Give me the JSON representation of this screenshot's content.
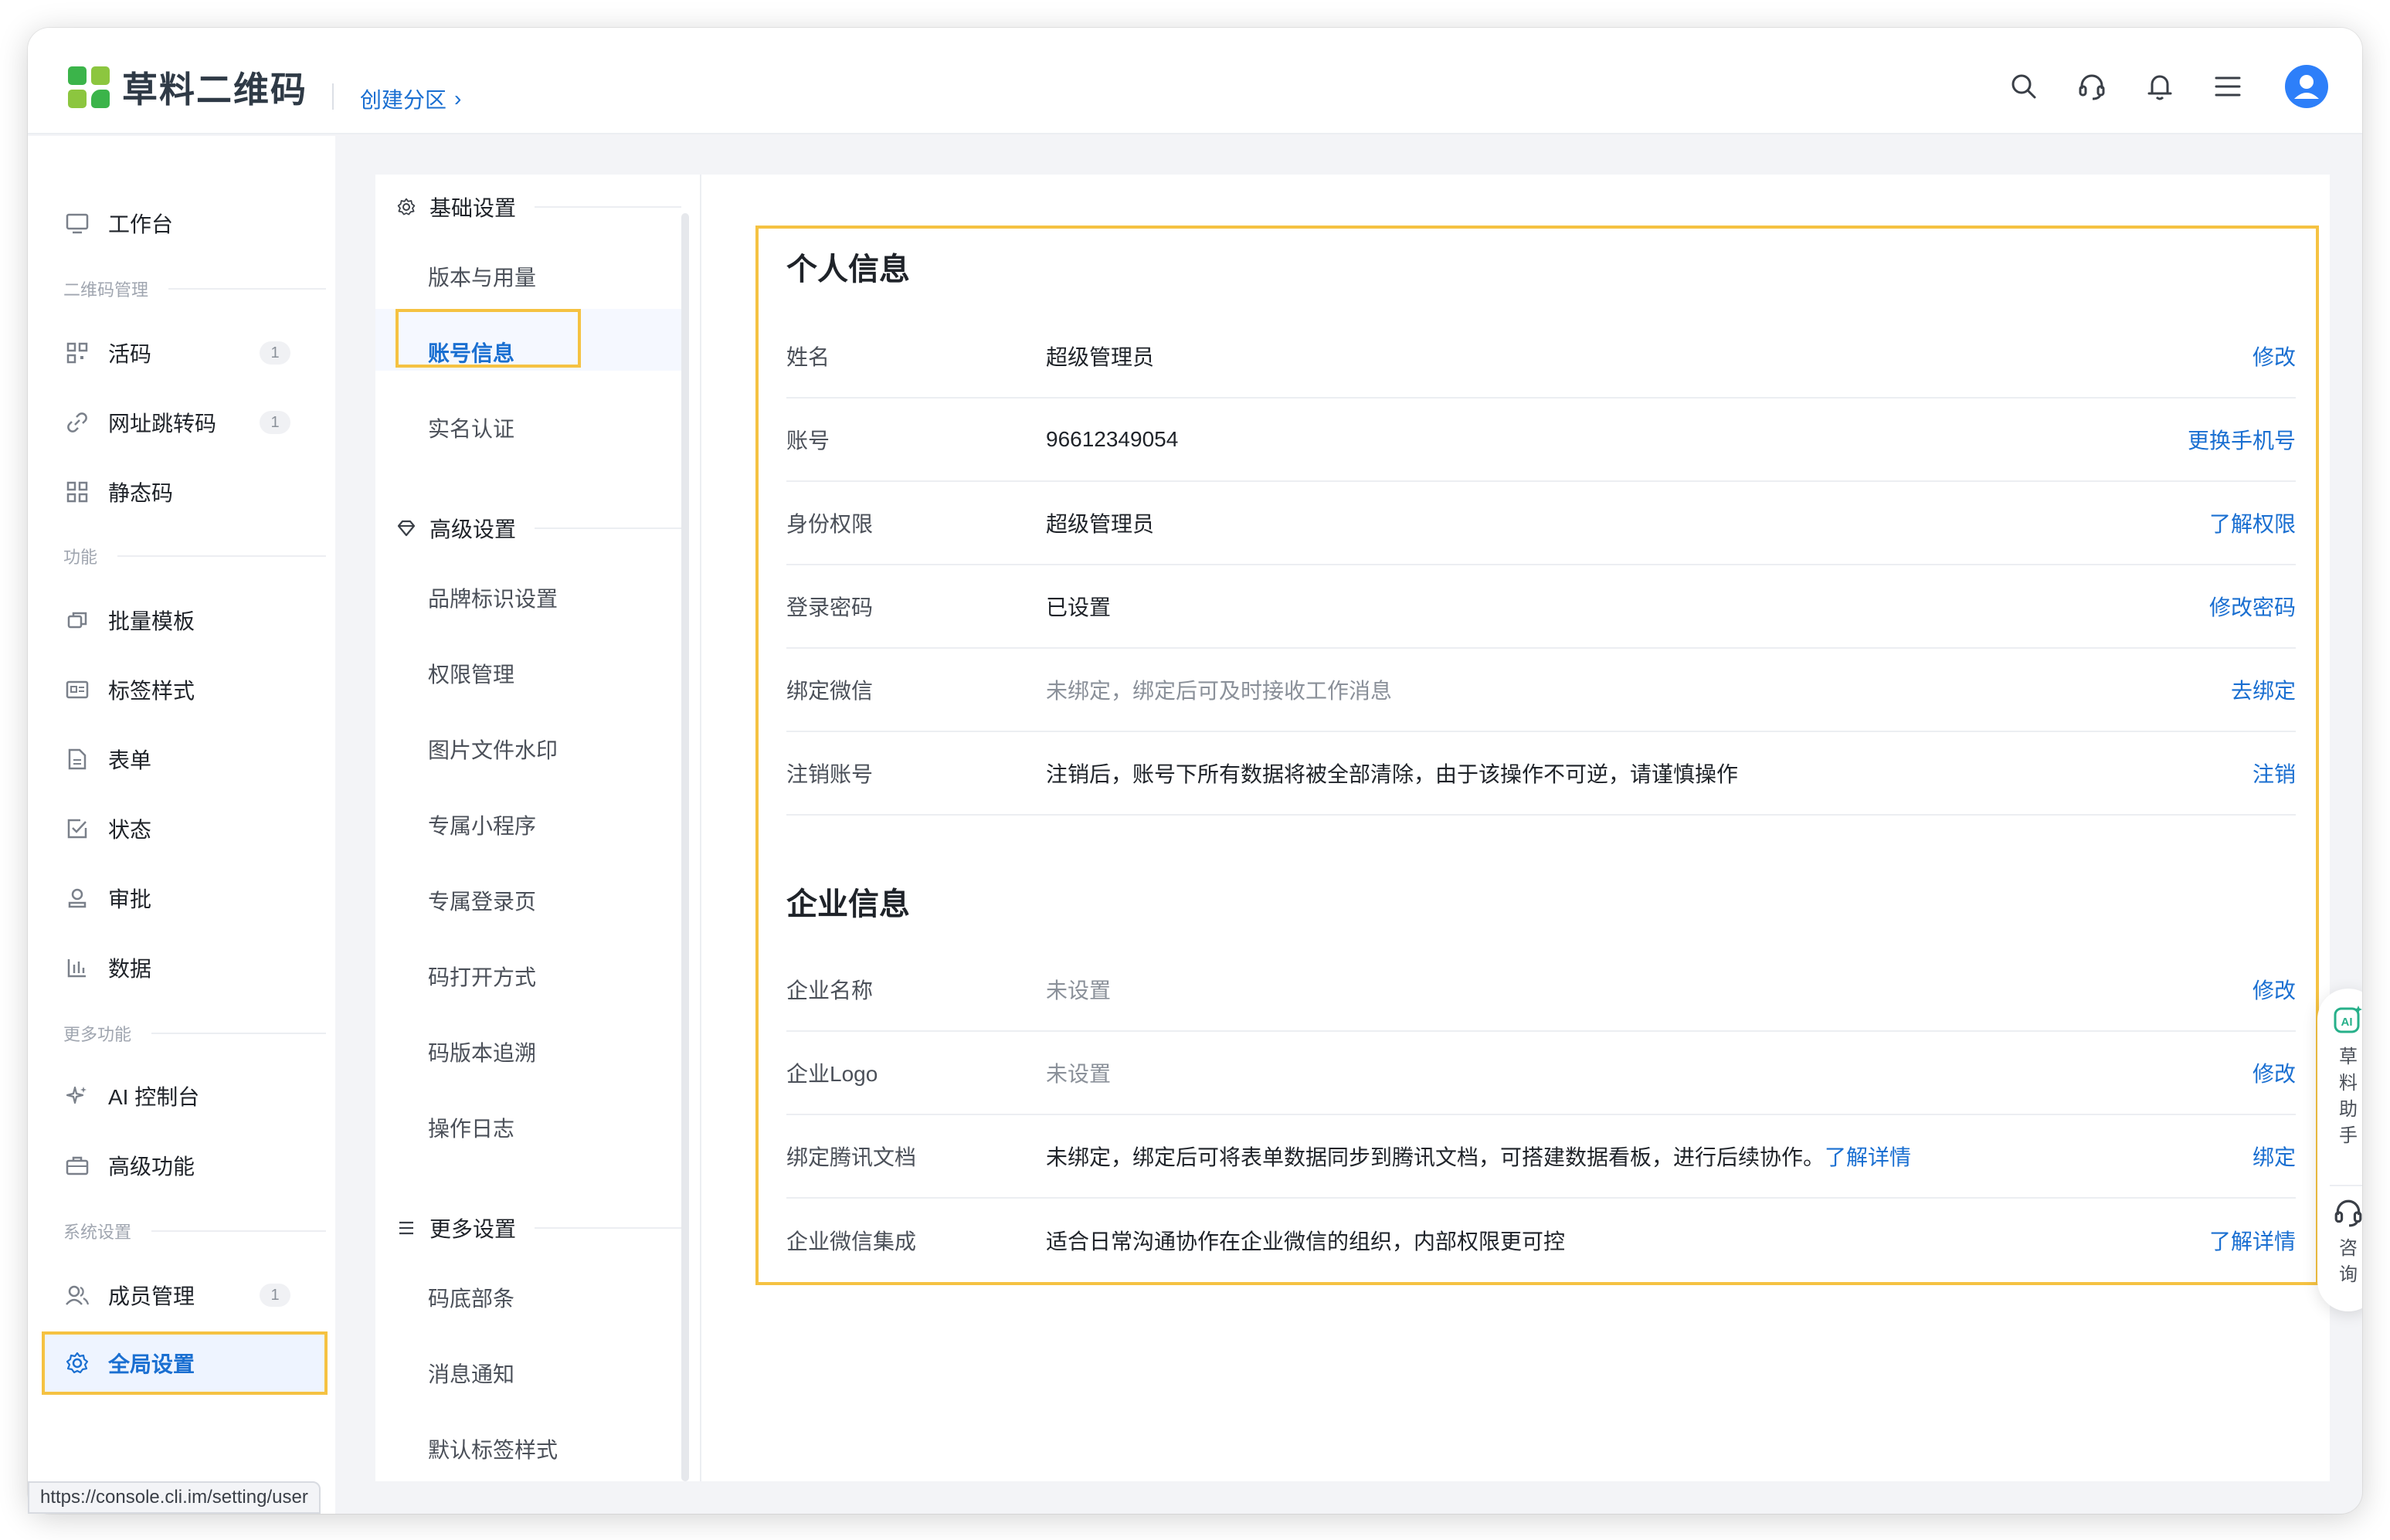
{
  "header": {
    "logo_text": "草料二维码",
    "breadcrumb": "创建分区",
    "icons": [
      "search-icon",
      "headset-icon",
      "bell-icon",
      "menu-icon",
      "avatar"
    ]
  },
  "sidebar": {
    "workbench": "工作台",
    "group_qr": "二维码管理",
    "live_code": "活码",
    "live_code_count": "1",
    "url_code": "网址跳转码",
    "url_code_count": "1",
    "static_code": "静态码",
    "group_func": "功能",
    "batch_template": "批量模板",
    "label_style": "标签样式",
    "form": "表单",
    "status": "状态",
    "approval": "审批",
    "data": "数据",
    "group_more": "更多功能",
    "ai_console": "AI 控制台",
    "advanced_func": "高级功能",
    "group_system": "系统设置",
    "members": "成员管理",
    "members_count": "1",
    "global_settings": "全局设置"
  },
  "subnav": {
    "group_basic": "基础设置",
    "version_usage": "版本与用量",
    "account_info": "账号信息",
    "real_name": "实名认证",
    "group_advanced": "高级设置",
    "brand_mark": "品牌标识设置",
    "permission": "权限管理",
    "watermark": "图片文件水印",
    "mini_program": "专属小程序",
    "login_page": "专属登录页",
    "open_mode": "码打开方式",
    "version_trace": "码版本追溯",
    "op_log": "操作日志",
    "group_more": "更多设置",
    "code_footer": "码底部条",
    "notification": "消息通知",
    "default_label": "默认标签样式"
  },
  "personal": {
    "title": "个人信息",
    "rows": [
      {
        "label": "姓名",
        "value": "超级管理员",
        "action": "修改",
        "muted": false
      },
      {
        "label": "账号",
        "value": "96612349054",
        "action": "更换手机号",
        "muted": false
      },
      {
        "label": "身份权限",
        "value": "超级管理员",
        "action": "了解权限",
        "muted": false
      },
      {
        "label": "登录密码",
        "value": "已设置",
        "action": "修改密码",
        "muted": false
      },
      {
        "label": "绑定微信",
        "value": "未绑定，绑定后可及时接收工作消息",
        "action": "去绑定",
        "muted": true
      },
      {
        "label": "注销账号",
        "value": "注销后，账号下所有数据将被全部清除，由于该操作不可逆，请谨慎操作",
        "action": "注销",
        "muted": false
      }
    ]
  },
  "enterprise": {
    "title": "企业信息",
    "name_label": "企业名称",
    "name_value": "未设置",
    "name_action": "修改",
    "logo_label": "企业Logo",
    "logo_value": "未设置",
    "logo_action": "修改",
    "tencent_label": "绑定腾讯文档",
    "tencent_value": "未绑定，绑定后可将表单数据同步到腾讯文档，可搭建数据看板，进行后续协作。",
    "tencent_link": "了解详情",
    "tencent_action": "绑定",
    "wecom_label": "企业微信集成",
    "wecom_value": "适合日常沟通协作在企业微信的组织，内部权限更可控",
    "wecom_action": "了解详情"
  },
  "float_helper": {
    "assistant": [
      "草",
      "料",
      "助",
      "手"
    ],
    "consult": [
      "咨",
      "询"
    ]
  },
  "status_url": "https://console.cli.im/setting/user",
  "colors": {
    "accent": "#1a6fd1",
    "highlight": "#f5c242",
    "brand_green": "#3bb44a"
  }
}
